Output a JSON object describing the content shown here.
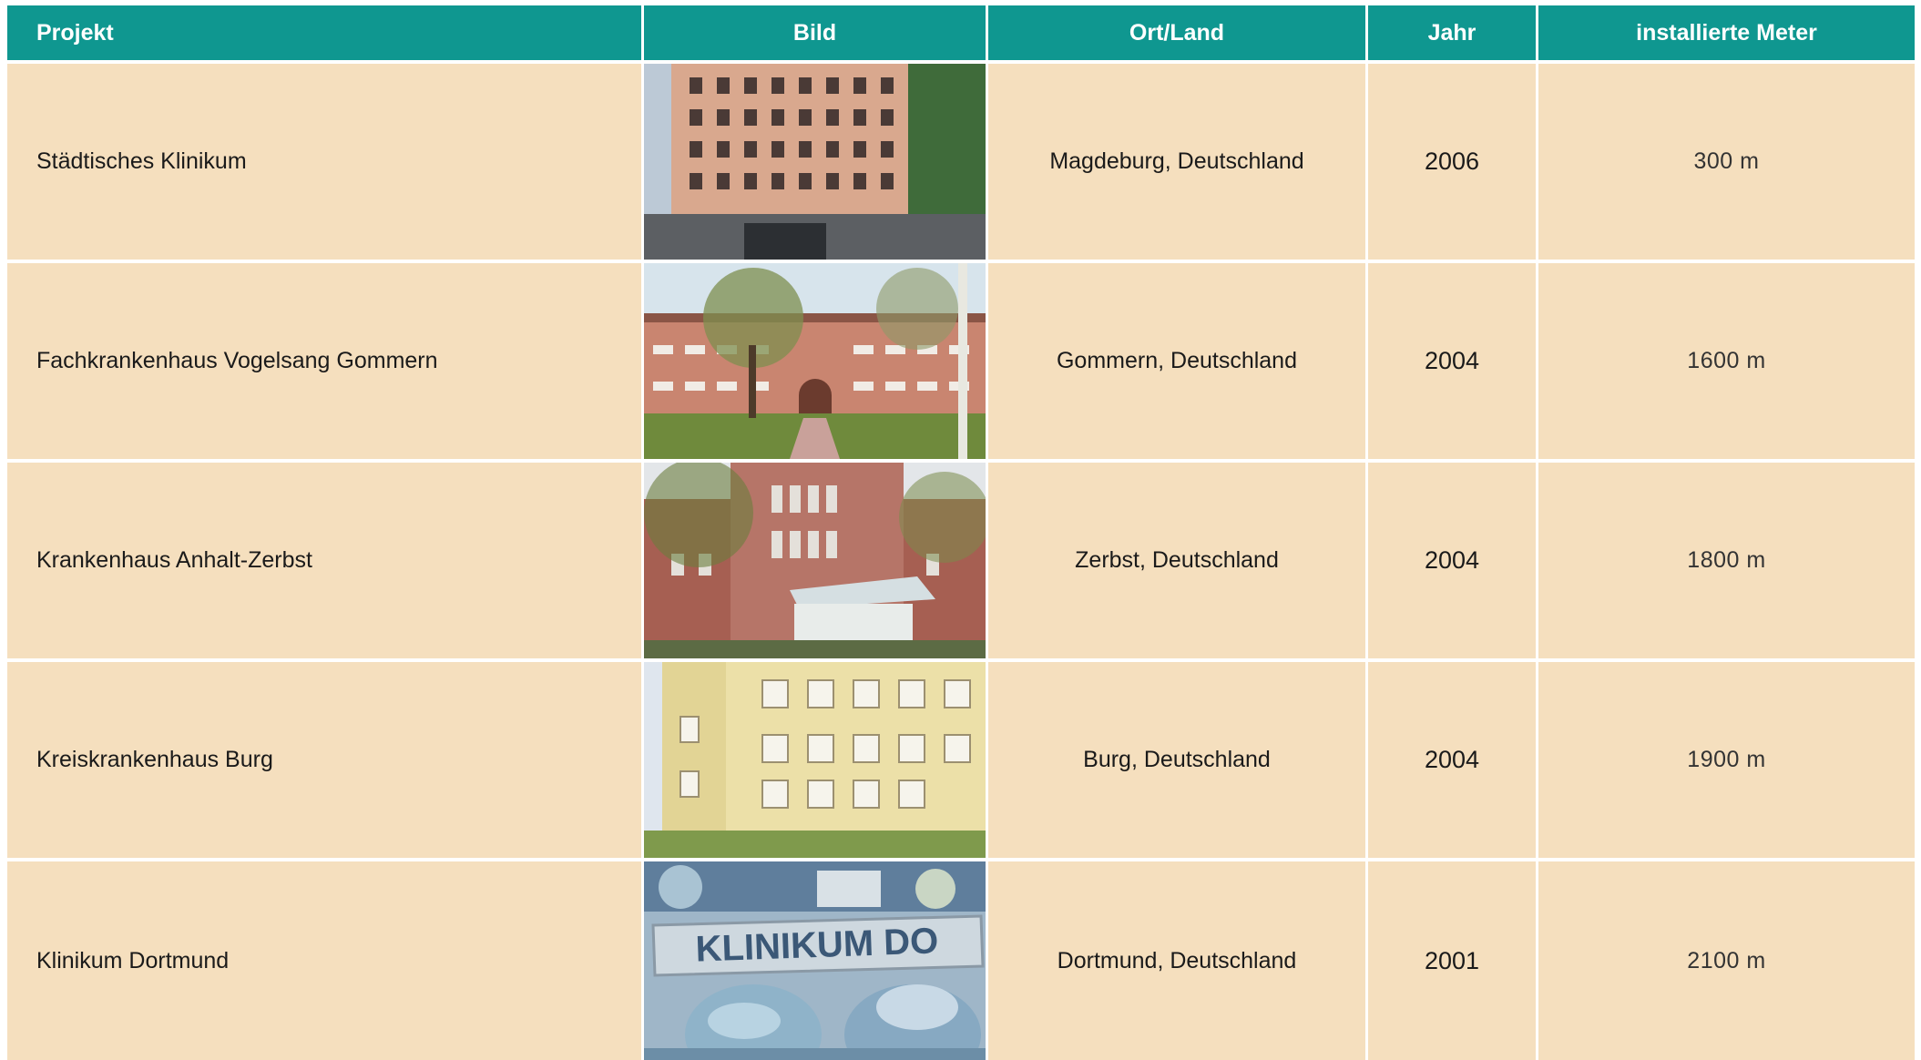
{
  "headers": {
    "projekt": "Projekt",
    "bild": "Bild",
    "ort": "Ort/Land",
    "jahr": "Jahr",
    "meter": "installierte Meter"
  },
  "rows": [
    {
      "projekt": "Städtisches Klinikum",
      "ort": "Magdeburg, Deutschland",
      "jahr": "2006",
      "meter": "300 m",
      "bild": "hospital-building-photo"
    },
    {
      "projekt": "Fachkrankenhaus Vogelsang Gommern",
      "ort": "Gommern, Deutschland",
      "jahr": "2004",
      "meter": "1600 m",
      "bild": "hospital-building-photo"
    },
    {
      "projekt": "Krankenhaus Anhalt-Zerbst",
      "ort": "Zerbst, Deutschland",
      "jahr": "2004",
      "meter": "1800 m",
      "bild": "hospital-building-photo"
    },
    {
      "projekt": "Kreiskrankenhaus Burg",
      "ort": "Burg, Deutschland",
      "jahr": "2004",
      "meter": "1900 m",
      "bild": "hospital-building-photo"
    },
    {
      "projekt": "Klinikum Dortmund",
      "ort": "Dortmund, Deutschland",
      "jahr": "2001",
      "meter": "2100 m",
      "bild": "hospital-staff-photo",
      "sign_text": "KLINIKUM DO"
    }
  ],
  "colors": {
    "header_bg": "#0f9790",
    "row_bg": "#f5dfbe"
  }
}
